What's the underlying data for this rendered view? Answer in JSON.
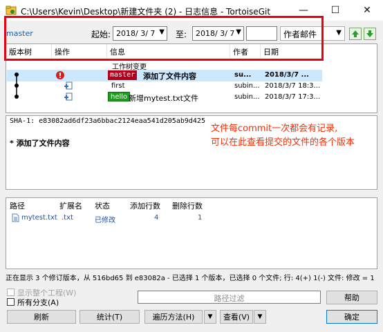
{
  "window": {
    "title": "C:\\Users\\Kevin\\Desktop\\新建文件夹 (2) - 日志信息 - TortoiseGit",
    "controls": {
      "minimize": "—",
      "maximize": "☐",
      "close": "✕"
    }
  },
  "toolbar": {
    "branch": "master",
    "from_label": "起始:",
    "from_date": "2018/ 3/ 7",
    "to_label": "至:",
    "to_date": "2018/ 3/ 7",
    "search_value": "",
    "filter_combo": "作者邮件"
  },
  "log_list": {
    "columns": [
      "版本树",
      "操作",
      "信息",
      "作者",
      "日期"
    ],
    "working_tree_row": "工作树变更",
    "rows": [
      {
        "tag": "master",
        "message": "添加了文件内容",
        "author": "su...",
        "date": "2018/3/7 ..."
      },
      {
        "tag": "",
        "message": "first",
        "author": "subin...",
        "date": "2018/3/7 18:3..."
      },
      {
        "tag": "hello",
        "message": "新增mytest.txt文件",
        "author": "subin...",
        "date": "2018/3/7 17:3..."
      }
    ]
  },
  "detail": {
    "sha": "SHA-1: e83082ad6df23a6bbac2124eaa541d205ab9d425",
    "message": "* 添加了文件内容",
    "annotation_lines": [
      "文件每commit一次都会有记录,",
      "可以在此查看提交的文件的各个版本"
    ]
  },
  "files": {
    "columns": [
      "路径",
      "扩展名",
      "状态",
      "添加行数",
      "删除行数"
    ],
    "rows": [
      {
        "path": "mytest.txt",
        "ext": ".txt",
        "status": "已修改",
        "added": "4",
        "deleted": "1"
      }
    ]
  },
  "status_text": "正在显示 3 个修订版本，从 516bd65 到 e83082a - 已选择 1 个版本，已选择 0 个文件; 行: 4(+) 1(-) 文件: 修改 = 1",
  "options": {
    "show_whole_project": "显示整个工程(W)",
    "all_branches": "所有分支(A)"
  },
  "path_filter_placeholder": "路径过滤",
  "buttons": {
    "help": "帮助",
    "refresh": "刷新",
    "statistics": "统计(T)",
    "walk_method": "遍历方法(H)",
    "view": "查看(V)",
    "ok": "确定"
  },
  "colors": {
    "selection": "#cce8ff",
    "master_tag": "#b3001b",
    "hello_tag": "#1e9e1e",
    "annotation": "#ff2a00",
    "highlight_box": "#e60012"
  },
  "icons": [
    "tortoisegit-app-icon",
    "arrow-up-icon",
    "arrow-down-icon",
    "modified-action-icon",
    "file-add-icon",
    "text-file-icon"
  ]
}
